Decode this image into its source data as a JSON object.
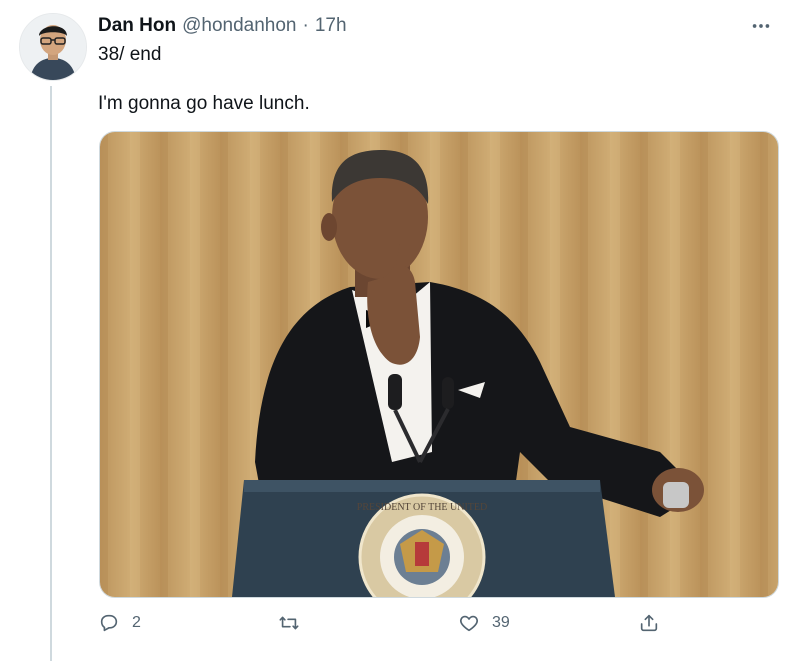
{
  "tweet": {
    "author": {
      "display_name": "Dan Hon",
      "handle": "@hondanhon",
      "separator": "·",
      "time": "17h"
    },
    "text_lines": [
      "38/ end",
      "I'm gonna go have lunch."
    ],
    "media": {
      "type": "gif",
      "seal_text": "PRESIDENT OF THE UNITED"
    },
    "actions": {
      "reply": {
        "icon": "reply-icon",
        "count": "2"
      },
      "retweet": {
        "icon": "retweet-icon",
        "count": ""
      },
      "like": {
        "icon": "heart-icon",
        "count": "39"
      },
      "share": {
        "icon": "share-icon"
      }
    },
    "menu_icon": "more-icon"
  },
  "colors": {
    "text_primary": "#0f1419",
    "text_secondary": "#536471",
    "border": "#cfd9de",
    "curtain": "#c9a66f",
    "podium": "#2f4150"
  }
}
